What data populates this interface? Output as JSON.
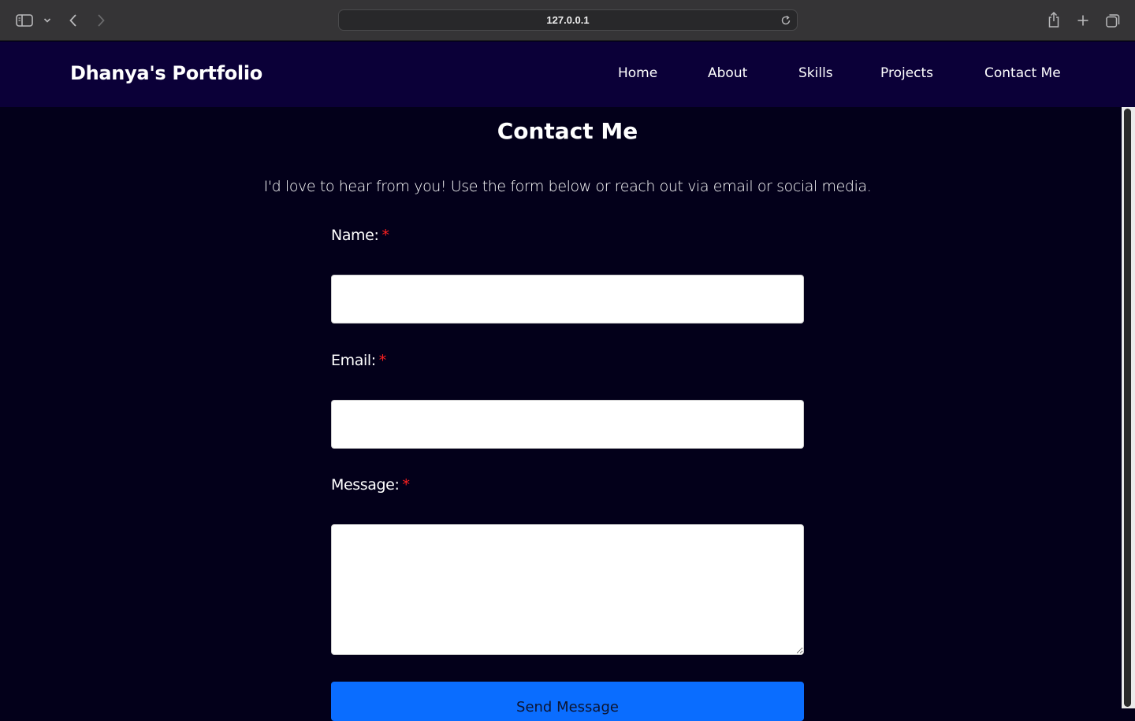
{
  "browser": {
    "url": "127.0.0.1",
    "icons": {
      "sidebar": "sidebar-toggle-icon",
      "chevron": "chevron-down-icon",
      "back": "back-arrow-icon",
      "forward": "forward-arrow-icon",
      "reload": "reload-icon",
      "share": "share-icon",
      "new_tab": "plus-icon",
      "tabs": "tab-overview-icon"
    }
  },
  "nav": {
    "brand": "Dhanya's Portfolio",
    "links": [
      "Home",
      "About",
      "Skills",
      "Projects",
      "Contact Me"
    ]
  },
  "contact": {
    "title": "Contact Me",
    "intro": "I'd love to hear from you! Use the form below or reach out via email or social media.",
    "name_label": "Name:",
    "email_label": "Email:",
    "message_label": "Message:",
    "required_marker": "*",
    "name_value": "",
    "email_value": "",
    "message_value": "",
    "submit_label": "Send Message"
  },
  "colors": {
    "page_bg": "#03001a",
    "nav_bg": "#0b0038",
    "button_bg": "#0a6dff",
    "required": "#ff2020"
  }
}
